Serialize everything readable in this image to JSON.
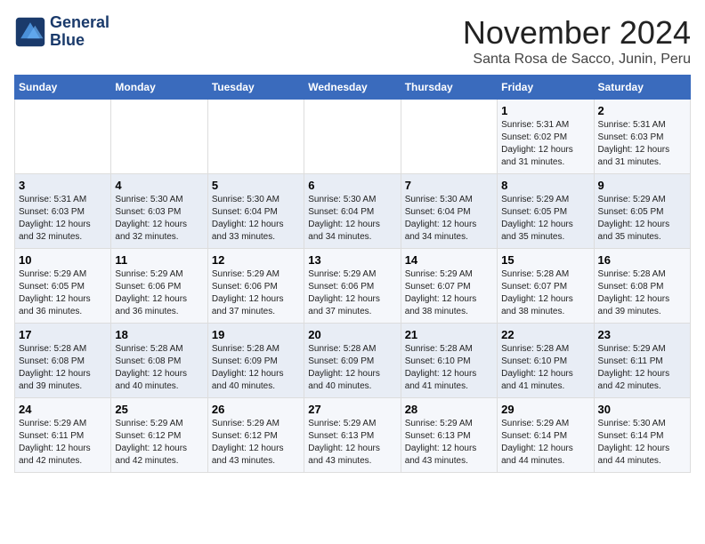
{
  "logo": {
    "line1": "General",
    "line2": "Blue"
  },
  "title": "November 2024",
  "location": "Santa Rosa de Sacco, Junin, Peru",
  "weekdays": [
    "Sunday",
    "Monday",
    "Tuesday",
    "Wednesday",
    "Thursday",
    "Friday",
    "Saturday"
  ],
  "weeks": [
    [
      {
        "day": "",
        "info": ""
      },
      {
        "day": "",
        "info": ""
      },
      {
        "day": "",
        "info": ""
      },
      {
        "day": "",
        "info": ""
      },
      {
        "day": "",
        "info": ""
      },
      {
        "day": "1",
        "info": "Sunrise: 5:31 AM\nSunset: 6:02 PM\nDaylight: 12 hours and 31 minutes."
      },
      {
        "day": "2",
        "info": "Sunrise: 5:31 AM\nSunset: 6:03 PM\nDaylight: 12 hours and 31 minutes."
      }
    ],
    [
      {
        "day": "3",
        "info": "Sunrise: 5:31 AM\nSunset: 6:03 PM\nDaylight: 12 hours and 32 minutes."
      },
      {
        "day": "4",
        "info": "Sunrise: 5:30 AM\nSunset: 6:03 PM\nDaylight: 12 hours and 32 minutes."
      },
      {
        "day": "5",
        "info": "Sunrise: 5:30 AM\nSunset: 6:04 PM\nDaylight: 12 hours and 33 minutes."
      },
      {
        "day": "6",
        "info": "Sunrise: 5:30 AM\nSunset: 6:04 PM\nDaylight: 12 hours and 34 minutes."
      },
      {
        "day": "7",
        "info": "Sunrise: 5:30 AM\nSunset: 6:04 PM\nDaylight: 12 hours and 34 minutes."
      },
      {
        "day": "8",
        "info": "Sunrise: 5:29 AM\nSunset: 6:05 PM\nDaylight: 12 hours and 35 minutes."
      },
      {
        "day": "9",
        "info": "Sunrise: 5:29 AM\nSunset: 6:05 PM\nDaylight: 12 hours and 35 minutes."
      }
    ],
    [
      {
        "day": "10",
        "info": "Sunrise: 5:29 AM\nSunset: 6:05 PM\nDaylight: 12 hours and 36 minutes."
      },
      {
        "day": "11",
        "info": "Sunrise: 5:29 AM\nSunset: 6:06 PM\nDaylight: 12 hours and 36 minutes."
      },
      {
        "day": "12",
        "info": "Sunrise: 5:29 AM\nSunset: 6:06 PM\nDaylight: 12 hours and 37 minutes."
      },
      {
        "day": "13",
        "info": "Sunrise: 5:29 AM\nSunset: 6:06 PM\nDaylight: 12 hours and 37 minutes."
      },
      {
        "day": "14",
        "info": "Sunrise: 5:29 AM\nSunset: 6:07 PM\nDaylight: 12 hours and 38 minutes."
      },
      {
        "day": "15",
        "info": "Sunrise: 5:28 AM\nSunset: 6:07 PM\nDaylight: 12 hours and 38 minutes."
      },
      {
        "day": "16",
        "info": "Sunrise: 5:28 AM\nSunset: 6:08 PM\nDaylight: 12 hours and 39 minutes."
      }
    ],
    [
      {
        "day": "17",
        "info": "Sunrise: 5:28 AM\nSunset: 6:08 PM\nDaylight: 12 hours and 39 minutes."
      },
      {
        "day": "18",
        "info": "Sunrise: 5:28 AM\nSunset: 6:08 PM\nDaylight: 12 hours and 40 minutes."
      },
      {
        "day": "19",
        "info": "Sunrise: 5:28 AM\nSunset: 6:09 PM\nDaylight: 12 hours and 40 minutes."
      },
      {
        "day": "20",
        "info": "Sunrise: 5:28 AM\nSunset: 6:09 PM\nDaylight: 12 hours and 40 minutes."
      },
      {
        "day": "21",
        "info": "Sunrise: 5:28 AM\nSunset: 6:10 PM\nDaylight: 12 hours and 41 minutes."
      },
      {
        "day": "22",
        "info": "Sunrise: 5:28 AM\nSunset: 6:10 PM\nDaylight: 12 hours and 41 minutes."
      },
      {
        "day": "23",
        "info": "Sunrise: 5:29 AM\nSunset: 6:11 PM\nDaylight: 12 hours and 42 minutes."
      }
    ],
    [
      {
        "day": "24",
        "info": "Sunrise: 5:29 AM\nSunset: 6:11 PM\nDaylight: 12 hours and 42 minutes."
      },
      {
        "day": "25",
        "info": "Sunrise: 5:29 AM\nSunset: 6:12 PM\nDaylight: 12 hours and 42 minutes."
      },
      {
        "day": "26",
        "info": "Sunrise: 5:29 AM\nSunset: 6:12 PM\nDaylight: 12 hours and 43 minutes."
      },
      {
        "day": "27",
        "info": "Sunrise: 5:29 AM\nSunset: 6:13 PM\nDaylight: 12 hours and 43 minutes."
      },
      {
        "day": "28",
        "info": "Sunrise: 5:29 AM\nSunset: 6:13 PM\nDaylight: 12 hours and 43 minutes."
      },
      {
        "day": "29",
        "info": "Sunrise: 5:29 AM\nSunset: 6:14 PM\nDaylight: 12 hours and 44 minutes."
      },
      {
        "day": "30",
        "info": "Sunrise: 5:30 AM\nSunset: 6:14 PM\nDaylight: 12 hours and 44 minutes."
      }
    ]
  ]
}
